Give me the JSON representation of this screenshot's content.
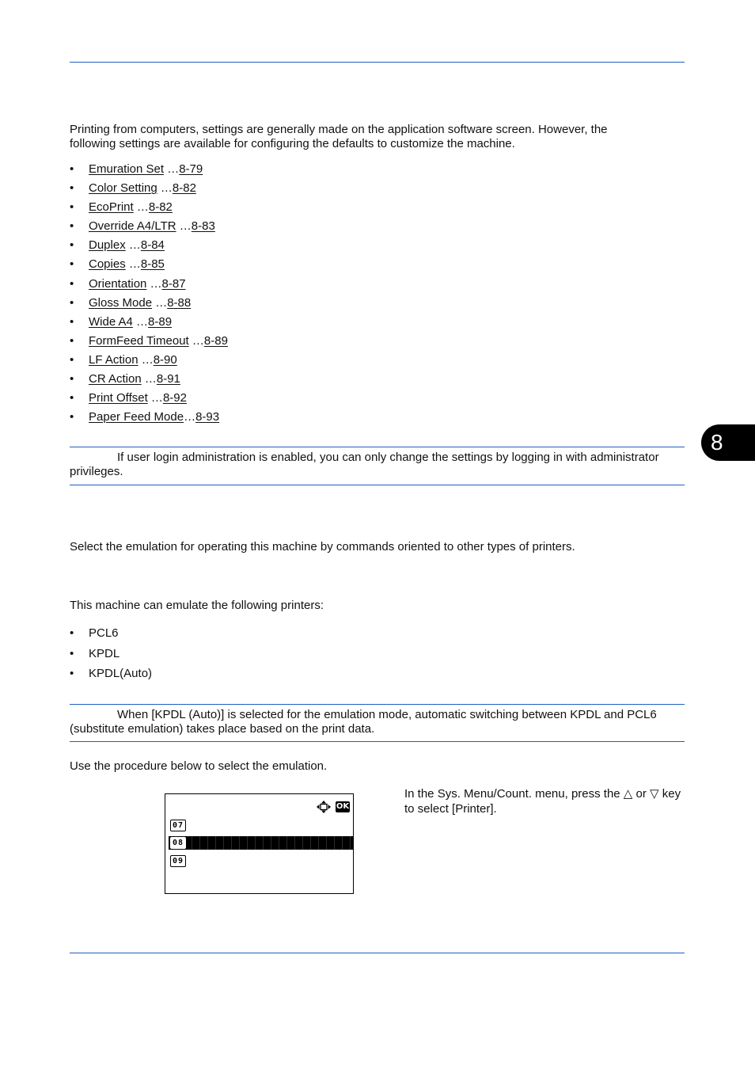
{
  "chapter_tab": {
    "label": "8"
  },
  "intro": {
    "text": "Printing from computers, settings are generally made on the application software screen. However, the following settings are available for configuring the defaults to customize the machine."
  },
  "settings_list": [
    {
      "label": "Emuration Set",
      "sep": " …",
      "page": "8-79"
    },
    {
      "label": "Color Setting",
      "sep": " …",
      "page": "8-82"
    },
    {
      "label": "EcoPrint",
      "sep": " …",
      "page": "8-82"
    },
    {
      "label": "Override A4/LTR",
      "sep": " …",
      "page": "8-83"
    },
    {
      "label": "Duplex",
      "sep": " …",
      "page": "8-84"
    },
    {
      "label": "Copies",
      "sep": " …",
      "page": "8-85"
    },
    {
      "label": "Orientation",
      "sep": " …",
      "page": "8-87"
    },
    {
      "label": "Gloss Mode",
      "sep": " …",
      "page": "8-88"
    },
    {
      "label": "Wide A4",
      "sep": " …",
      "page": "8-89"
    },
    {
      "label": "FormFeed Timeout",
      "sep": " …",
      "page": "8-89"
    },
    {
      "label": "LF Action",
      "sep": " …",
      "page": "8-90"
    },
    {
      "label": "CR Action",
      "sep": " …",
      "page": "8-91"
    },
    {
      "label": "Print Offset",
      "sep": " …",
      "page": "8-92"
    },
    {
      "label": "Paper Feed Mode",
      "sep": "…",
      "page": "8-93"
    }
  ],
  "bullet": "•",
  "note1": {
    "text": "If user login administration is enabled, you can only change the settings by logging in with administrator privileges."
  },
  "emulation": {
    "description": "Select the emulation for operating this machine by commands oriented to other types of printers.",
    "can_emulate": "This machine can emulate the following printers:",
    "printers": [
      "PCL6",
      "KPDL",
      "KPDL(Auto)"
    ],
    "note": "When [KPDL (Auto)] is selected for the emulation mode, automatic switching between KPDL and PCL6 (substitute emulation) takes place based on the print data.",
    "procedure_intro": "Use the procedure below to select the emulation."
  },
  "lcd": {
    "nav_icon": "four-way-arrow-icon",
    "ok_label": "OK",
    "rows": [
      {
        "num": "07",
        "selected": false
      },
      {
        "num": "08",
        "selected": true
      },
      {
        "num": "09",
        "selected": false
      }
    ]
  },
  "step1": {
    "text": "In the Sys. Menu/Count. menu, press the △ or ▽ key to select [Printer]."
  },
  "colors": {
    "rule": "#1f5fbf",
    "tab": "#000000"
  }
}
